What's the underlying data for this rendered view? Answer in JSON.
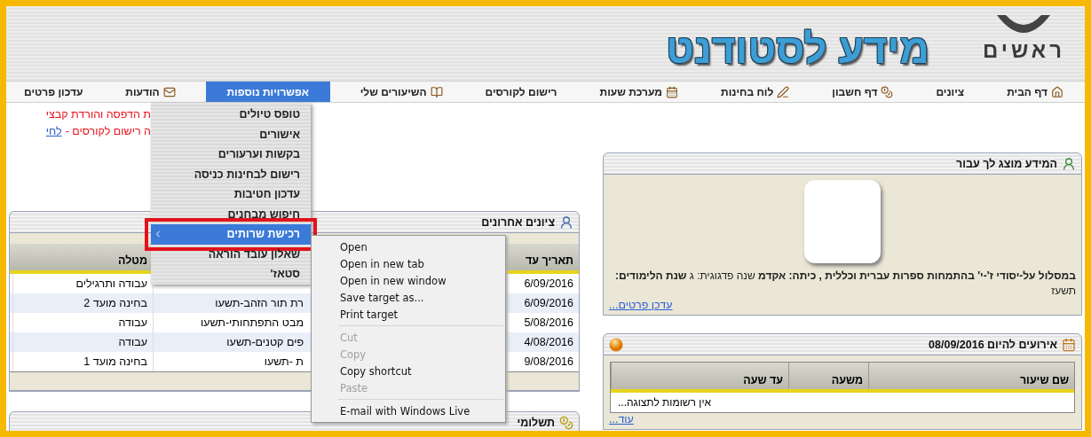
{
  "header": {
    "title": "מידע לסטודנט",
    "logo_text": "ראשים"
  },
  "nav": [
    {
      "label": "דף הבית",
      "selected": false
    },
    {
      "label": "ציונים",
      "selected": false
    },
    {
      "label": "דף חשבון",
      "selected": false
    },
    {
      "label": "לוח בחינות",
      "selected": false
    },
    {
      "label": "מערכת שעות",
      "selected": false
    },
    {
      "label": "רישום לקורסים",
      "selected": false
    },
    {
      "label": "השיעורים שלי",
      "selected": false
    },
    {
      "label": "אפשרויות נוספות",
      "selected": true
    },
    {
      "label": "הודעות",
      "selected": false
    },
    {
      "label": "עדכון פרטים",
      "selected": false
    }
  ],
  "more_menu": {
    "items": [
      {
        "label": "טופס טיולים",
        "selected": false,
        "marked": false
      },
      {
        "label": "אישורים",
        "selected": false,
        "marked": false
      },
      {
        "label": "בקשות וערעורים",
        "selected": false,
        "marked": false
      },
      {
        "label": "רישום לבחינות כניסה",
        "selected": false,
        "marked": false
      },
      {
        "label": "עדכון חטיבות",
        "selected": false,
        "marked": false
      },
      {
        "label": "חיפוש מבחנים",
        "selected": false,
        "marked": false
      },
      {
        "label": "רכישת שרותים",
        "selected": true,
        "marked": true
      },
      {
        "label": "שאלון עובד הוראה",
        "selected": false,
        "marked": false
      },
      {
        "label": "סטאז'",
        "selected": false,
        "marked": false
      }
    ]
  },
  "notice": {
    "line_1": "ת הדפסה והורדת קבצי",
    "line_2": "ה רישום לקורסים -",
    "link": "לחי"
  },
  "recent_grades": {
    "title": "ציונים אחרונים",
    "columns": [
      "תאריך עד",
      "מטלה"
    ],
    "rows": [
      {
        "date": "6/09/2016",
        "assignment": "עבודה ותרגילים"
      },
      {
        "date": "6/09/2016",
        "column_2": "רת תור הזהב-תשעו",
        "assignment": "בחינה מועד 2"
      },
      {
        "date": "5/08/2016",
        "column_2": "מבט התפתחותי-תשעו",
        "assignment": "עבודה"
      },
      {
        "date": "4/08/2016",
        "column_2": "פים קטנים-תשעו",
        "assignment": "עבודה"
      },
      {
        "date": "9/08/2016",
        "column_2": "ת -תשעו",
        "assignment": "בחינה מועד 1"
      }
    ]
  },
  "payments": {
    "title": "תשלומי"
  },
  "profile": {
    "title": "המידע מוצג לך עבור",
    "text": "**במסלול על-יסודי ז'-י' בהתמחות ספרות עברית וכללית , כיתה: אקדמ** שנה פדגוגית: ג **שנת הלימודים:** תשעז",
    "link": "עדכן פרטים..."
  },
  "events": {
    "title": "אירועים להיום 08/09/2016",
    "columns": [
      "שם שיעור",
      "משעה",
      "עד שעה"
    ],
    "empty": "אין רשומות לתצוגה...",
    "link": "עוד..."
  },
  "context_menu": {
    "items": [
      {
        "kind": "item",
        "label": "Open",
        "disabled": false
      },
      {
        "kind": "item",
        "label": "Open in new tab",
        "disabled": false
      },
      {
        "kind": "item",
        "label": "Open in new window",
        "disabled": false
      },
      {
        "kind": "item",
        "label": "Save target as...",
        "disabled": false
      },
      {
        "kind": "item",
        "label": "Print target",
        "disabled": false
      },
      {
        "kind": "separator"
      },
      {
        "kind": "item",
        "label": "Cut",
        "disabled": true
      },
      {
        "kind": "item",
        "label": "Copy",
        "disabled": true
      },
      {
        "kind": "item",
        "label": "Copy shortcut",
        "disabled": false
      },
      {
        "kind": "item",
        "label": "Paste",
        "disabled": true
      },
      {
        "kind": "separator"
      },
      {
        "kind": "item",
        "label": "E-mail with Windows Live",
        "disabled": false
      }
    ]
  }
}
